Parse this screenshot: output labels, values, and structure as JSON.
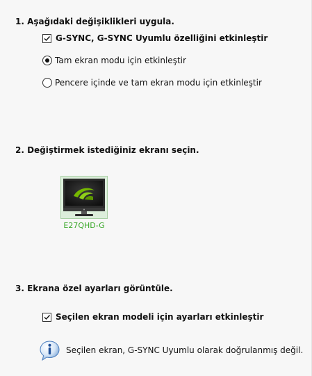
{
  "section1": {
    "heading": "1. Aşağıdaki değişiklikleri uygula.",
    "gsync_checkbox": {
      "label": "G-SYNC, G-SYNC Uyumlu özelliğini etkinleştir",
      "checked": true
    },
    "mode_options": [
      {
        "label": "Tam ekran modu için etkinleştir",
        "selected": true
      },
      {
        "label": "Pencere içinde ve tam ekran modu için etkinleştir",
        "selected": false
      }
    ]
  },
  "section2": {
    "heading": "2. Değiştirmek istediğiniz ekranı seçin.",
    "display": {
      "name": "E27QHD-G",
      "icon": "nvidia-monitor-icon",
      "selected": true
    }
  },
  "section3": {
    "heading": "3. Ekrana özel ayarları görüntüle.",
    "model_checkbox": {
      "label": "Seçilen ekran modeli için ayarları etkinleştir",
      "checked": true
    },
    "info": {
      "icon": "info-icon",
      "text": "Seçilen ekran, G-SYNC Uyumlu olarak doğrulanmış değil."
    }
  },
  "colors": {
    "background": "#f7f7f7",
    "display_label": "#3aa82a",
    "display_selection": "#dceedb",
    "nvidia_green": "#76b900"
  }
}
